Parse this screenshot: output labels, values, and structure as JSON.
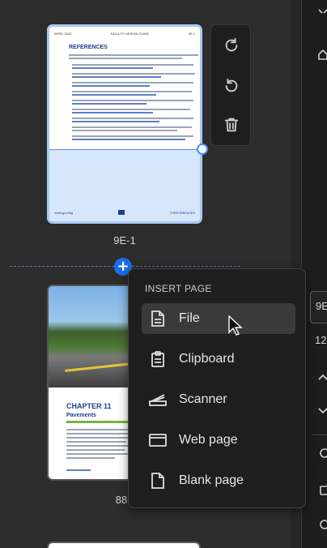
{
  "pages": [
    {
      "label": "9E-1",
      "selected": true,
      "header_left": "APRIL 2024",
      "header_center": "FACILITY DESIGN GUIDE",
      "header_right": "9E-1",
      "heading": "REFERENCES",
      "footer_left": "mdot.gov/fdg",
      "footer_right": "9 REFERENCES"
    },
    {
      "label": "88",
      "selected": false,
      "chapter": "CHAPTER 11",
      "chapter_title": "Pavements"
    }
  ],
  "page_tools": {
    "rotate_clockwise": "rotate-clockwise-icon",
    "rotate_counterclockwise": "rotate-counterclockwise-icon",
    "delete": "trash-icon"
  },
  "insert_menu": {
    "title": "INSERT PAGE",
    "items": [
      {
        "label": "File",
        "icon": "file-icon",
        "active": true
      },
      {
        "label": "Clipboard",
        "icon": "clipboard-icon",
        "active": false
      },
      {
        "label": "Scanner",
        "icon": "scanner-icon",
        "active": false
      },
      {
        "label": "Web page",
        "icon": "web-page-icon",
        "active": false
      },
      {
        "label": "Blank page",
        "icon": "blank-page-icon",
        "active": false
      }
    ]
  },
  "right_rail": {
    "page_box_text": "9E",
    "page_count_text": "12"
  },
  "colors": {
    "accent": "#1a6fe8",
    "selection": "#d6e6fb",
    "menu_bg": "#1e1e1e",
    "panel_bg": "#2c2c2c"
  }
}
